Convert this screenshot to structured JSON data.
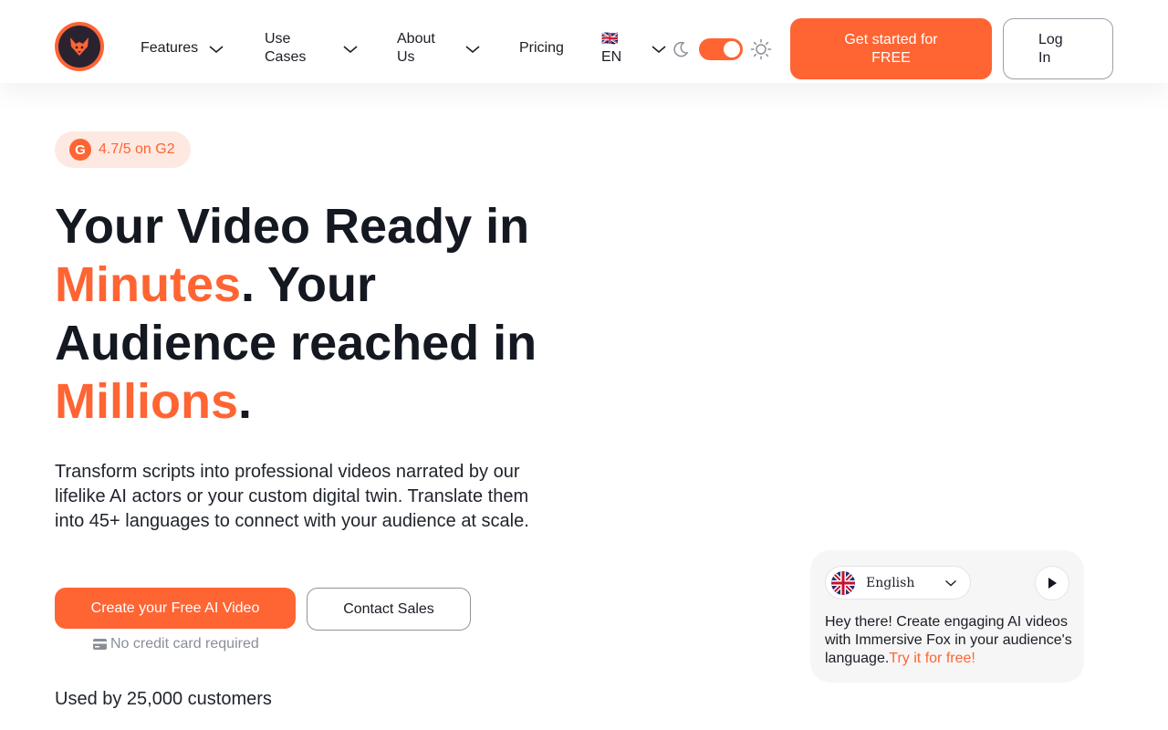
{
  "header": {
    "logo": "immersive-fox-logo",
    "nav": {
      "features": "Features",
      "use_cases_1": "Use",
      "use_cases_2": "Cases",
      "about_us_1": "About",
      "about_us_2": "Us",
      "pricing": "Pricing",
      "lang_flag": "🇬🇧",
      "lang_code": "EN"
    },
    "theme": {
      "dark_icon": "moon-icon",
      "light_icon": "sun-icon",
      "light_mode_on": true
    },
    "cta_line1": "Get started for",
    "cta_line2": "FREE",
    "login_line1": "Log",
    "login_line2": "In"
  },
  "hero": {
    "rating_icon": "G",
    "rating": "4.7/5 on G2",
    "title": {
      "p1": "Your Video Ready in ",
      "accent1": "Minutes",
      "p2": ". Your Audience reached in ",
      "accent2": "Millions",
      "p3": "."
    },
    "description": "Transform scripts into professional videos narrated by our lifelike AI actors or your custom digital twin. Translate them into 45+ languages to connect with your audience at scale.",
    "create_button": "Create your Free AI Video",
    "contact_button": "Contact Sales",
    "no_credit_card": "No credit card required",
    "used_by": "Used by 25,000 customers"
  },
  "widget": {
    "language": "English",
    "text": "Hey there! Create engaging AI videos with Immersive Fox in your audience's language.",
    "link": "Try it for free!"
  },
  "colors": {
    "accent": "#ff6433",
    "text": "#141821"
  }
}
